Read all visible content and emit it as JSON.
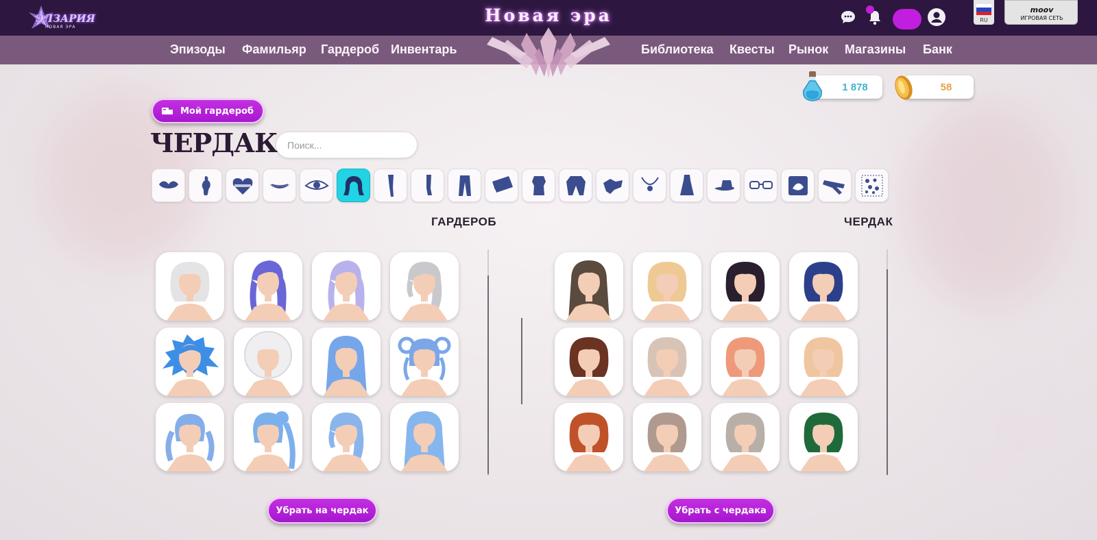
{
  "header": {
    "logo_text": "ЭЛЗАРИЯ",
    "logo_sub": "НОВАЯ ЭРА",
    "site_title": "Новая эра",
    "lang_code": "RU",
    "partner_brand": "moov",
    "partner_sub": "ИГРОВАЯ СЕТЬ"
  },
  "nav": {
    "left": [
      "Эпизоды",
      "Фамильяр",
      "Гардероб",
      "Инвентарь"
    ],
    "right": [
      "Библиотека",
      "Квесты",
      "Рынок",
      "Магазины",
      "Банк"
    ]
  },
  "currency": {
    "potions": "1 878",
    "coins": "58"
  },
  "page": {
    "my_wardrobe_label": "Мой гардероб",
    "heading": "ЧЕРДАК",
    "search_placeholder": "Поиск...",
    "wardrobe_title": "ГАРДЕРОБ",
    "attic_title": "ЧЕРДАК",
    "move_to_attic": "Убрать на чердак",
    "move_from_attic": "Убрать с чердака"
  },
  "categories": [
    {
      "name": "makeup-lips",
      "icon": "lips-icon"
    },
    {
      "name": "body",
      "icon": "body-icon"
    },
    {
      "name": "tattoo",
      "icon": "heart-tattoo-icon"
    },
    {
      "name": "mouth",
      "icon": "mouth-icon"
    },
    {
      "name": "eyes",
      "icon": "eye-icon"
    },
    {
      "name": "hair",
      "icon": "hair-icon",
      "active": true
    },
    {
      "name": "legs-skin",
      "icon": "leg-icon"
    },
    {
      "name": "socks",
      "icon": "stocking-icon"
    },
    {
      "name": "pants",
      "icon": "pants-icon"
    },
    {
      "name": "skirt",
      "icon": "skirt-icon"
    },
    {
      "name": "top",
      "icon": "top-icon"
    },
    {
      "name": "jacket",
      "icon": "jacket-icon"
    },
    {
      "name": "gloves",
      "icon": "gloves-icon"
    },
    {
      "name": "necklace",
      "icon": "necklace-icon"
    },
    {
      "name": "dress",
      "icon": "dress-icon"
    },
    {
      "name": "hat",
      "icon": "hat-icon"
    },
    {
      "name": "glasses",
      "icon": "glasses-icon"
    },
    {
      "name": "background",
      "icon": "background-icon"
    },
    {
      "name": "accessory",
      "icon": "scarf-icon"
    },
    {
      "name": "pattern",
      "icon": "pattern-icon"
    }
  ],
  "wardrobe_items": [
    {
      "color": "#e4e4e6",
      "style": "short"
    },
    {
      "color": "#6a66d8",
      "style": "ponytail"
    },
    {
      "color": "#b8b2ec",
      "style": "ponytail"
    },
    {
      "color": "#c9c9cd",
      "style": "side"
    },
    {
      "color": "#3d8ee6",
      "style": "spiky"
    },
    {
      "color": "#efeff2",
      "style": "afro"
    },
    {
      "color": "#76a6ea",
      "style": "long"
    },
    {
      "color": "#7ba7e8",
      "style": "braids-loop"
    },
    {
      "color": "#84aeea",
      "style": "pigtails"
    },
    {
      "color": "#7cb0ec",
      "style": "braid"
    },
    {
      "color": "#8ab4ec",
      "style": "side"
    },
    {
      "color": "#86b6ee",
      "style": "long"
    }
  ],
  "attic_items": [
    {
      "color": "#5b4a3e",
      "style": "long"
    },
    {
      "color": "#efc994",
      "style": "short"
    },
    {
      "color": "#2a1f2e",
      "style": "short"
    },
    {
      "color": "#2c3f8a",
      "style": "short"
    },
    {
      "color": "#6a3322",
      "style": "short"
    },
    {
      "color": "#d8c4b6",
      "style": "short"
    },
    {
      "color": "#ee9a7a",
      "style": "short"
    },
    {
      "color": "#f0c6a0",
      "style": "short"
    },
    {
      "color": "#c0522a",
      "style": "short"
    },
    {
      "color": "#b09a90",
      "style": "short"
    },
    {
      "color": "#b8b0a8",
      "style": "short"
    },
    {
      "color": "#1f6a3a",
      "style": "short"
    }
  ]
}
